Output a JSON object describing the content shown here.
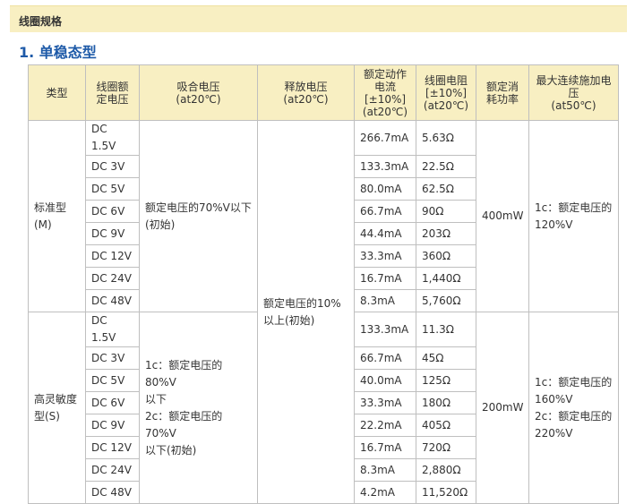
{
  "section_title": "线圈规格",
  "subtitle": "1. 单稳态型",
  "table": {
    "headers": [
      "类型",
      "线圈额\n定电压",
      "吸合电压\n(at20℃)",
      "释放电压\n(at20℃)",
      "额定动作\n电流\n[±10%]\n(at20℃)",
      "线圈电阻\n[±10%]\n(at20℃)",
      "额定消\n耗功率",
      "最大连续施加电\n压\n(at50℃)"
    ],
    "release_voltage": "额定电压的10%\n以上(初始)",
    "groups": [
      {
        "type": "标准型\n(M)",
        "pickup": "额定电压的70%V以下\n(初始)",
        "power": "400mW",
        "max_voltage": "1c：额定电压的\n120%V",
        "rows": [
          {
            "voltage": "DC 1.5V",
            "current": "266.7mA",
            "resistance": "5.63Ω"
          },
          {
            "voltage": "DC 3V",
            "current": "133.3mA",
            "resistance": "22.5Ω"
          },
          {
            "voltage": "DC 5V",
            "current": "80.0mA",
            "resistance": "62.5Ω"
          },
          {
            "voltage": "DC 6V",
            "current": "66.7mA",
            "resistance": "90Ω"
          },
          {
            "voltage": "DC 9V",
            "current": "44.4mA",
            "resistance": "203Ω"
          },
          {
            "voltage": "DC 12V",
            "current": "33.3mA",
            "resistance": "360Ω"
          },
          {
            "voltage": "DC 24V",
            "current": "16.7mA",
            "resistance": "1,440Ω"
          },
          {
            "voltage": "DC 48V",
            "current": "8.3mA",
            "resistance": "5,760Ω"
          }
        ]
      },
      {
        "type": "高灵敏度\n型(S)",
        "pickup": "1c：额定电压的80%V\n以下\n2c：额定电压的70%V\n以下(初始)",
        "power": "200mW",
        "max_voltage": "1c：额定电压的\n160%V\n2c：额定电压的\n220%V",
        "rows": [
          {
            "voltage": "DC 1.5V",
            "current": "133.3mA",
            "resistance": "11.3Ω"
          },
          {
            "voltage": "DC 3V",
            "current": "66.7mA",
            "resistance": "45Ω"
          },
          {
            "voltage": "DC 5V",
            "current": "40.0mA",
            "resistance": "125Ω"
          },
          {
            "voltage": "DC 6V",
            "current": "33.3mA",
            "resistance": "180Ω"
          },
          {
            "voltage": "DC 9V",
            "current": "22.2mA",
            "resistance": "405Ω"
          },
          {
            "voltage": "DC 12V",
            "current": "16.7mA",
            "resistance": "720Ω"
          },
          {
            "voltage": "DC 24V",
            "current": "8.3mA",
            "resistance": "2,880Ω"
          },
          {
            "voltage": "DC 48V",
            "current": "4.2mA",
            "resistance": "11,520Ω"
          }
        ]
      }
    ]
  }
}
